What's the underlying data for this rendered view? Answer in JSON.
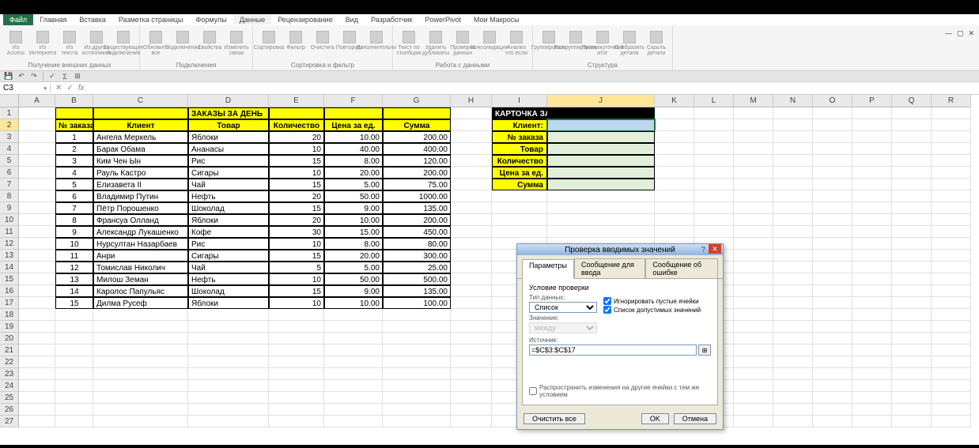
{
  "namebox": "C3",
  "ribbon_tabs": {
    "file": "Файл",
    "items": [
      "Главная",
      "Вставка",
      "Разметка страницы",
      "Формулы",
      "Данные",
      "Рецензирование",
      "Вид",
      "Разработчик",
      "PowerPivot",
      "Мои Макросы"
    ],
    "active_index": 4
  },
  "ribbon_groups": [
    {
      "label": "Получение внешних данных",
      "icons": [
        "Из Access",
        "Из Интернета",
        "Из текста",
        "Из других источников",
        "Существующие подключения"
      ]
    },
    {
      "label": "Подключения",
      "icons": [
        "Обновить все",
        "Подключения",
        "Свойства",
        "Изменить связи"
      ]
    },
    {
      "label": "Сортировка и фильтр",
      "icons": [
        "Сортировка",
        "Фильтр",
        "Очистить",
        "Повторить",
        "Дополнительно"
      ]
    },
    {
      "label": "Работа с данными",
      "icons": [
        "Текст по столбцам",
        "Удалить дубликаты",
        "Проверка данных",
        "Консолидация",
        "Анализ что если"
      ]
    },
    {
      "label": "Структура",
      "icons": [
        "Группировать",
        "Разгруппировать",
        "Промежуточный итог",
        "Отобразить детали",
        "Скрыть детали"
      ]
    }
  ],
  "col_letters": [
    "A",
    "B",
    "C",
    "D",
    "E",
    "F",
    "G",
    "H",
    "I",
    "J",
    "K",
    "L",
    "M",
    "N",
    "O",
    "P",
    "Q",
    "R"
  ],
  "row_numbers": [
    1,
    2,
    3,
    4,
    5,
    6,
    7,
    8,
    9,
    10,
    11,
    12,
    13,
    14,
    15,
    16,
    17,
    18,
    19,
    20,
    21,
    22,
    23,
    24,
    25,
    26,
    27
  ],
  "left_table": {
    "title": "ЗАКАЗЫ ЗА ДЕНЬ",
    "headers": [
      "№ заказа",
      "Клиент",
      "Товар",
      "Количество",
      "Цена за ед.",
      "Сумма"
    ],
    "rows": [
      [
        "1",
        "Ангела Меркель",
        "Яблоки",
        "20",
        "10.00",
        "200.00"
      ],
      [
        "2",
        "Барак Обама",
        "Ананасы",
        "10",
        "40.00",
        "400.00"
      ],
      [
        "3",
        "Ким Чен Ын",
        "Рис",
        "15",
        "8.00",
        "120.00"
      ],
      [
        "4",
        "Рауль Кастро",
        "Сигары",
        "10",
        "20.00",
        "200.00"
      ],
      [
        "5",
        "Елизавета II",
        "Чай",
        "15",
        "5.00",
        "75.00"
      ],
      [
        "6",
        "Владимир Путин",
        "Нефть",
        "20",
        "50.00",
        "1000.00"
      ],
      [
        "7",
        "Пётр Порошенко",
        "Шоколад",
        "15",
        "9.00",
        "135.00"
      ],
      [
        "8",
        "Франсуа Олланд",
        "Яблоки",
        "20",
        "10.00",
        "200.00"
      ],
      [
        "9",
        "Александр Лукашенко",
        "Кофе",
        "30",
        "15.00",
        "450.00"
      ],
      [
        "10",
        "Нурсултан Назарбаев",
        "Рис",
        "10",
        "8.00",
        "80.00"
      ],
      [
        "11",
        "Анри",
        "Сигары",
        "15",
        "20.00",
        "300.00"
      ],
      [
        "12",
        "Томислав Николич",
        "Чай",
        "5",
        "5.00",
        "25.00"
      ],
      [
        "13",
        "Милош Земан",
        "Нефть",
        "10",
        "50.00",
        "500.00"
      ],
      [
        "14",
        "Каролос Папульяс",
        "Шоколад",
        "15",
        "9.00",
        "135.00"
      ],
      [
        "15",
        "Дилма Русеф",
        "Яблоки",
        "10",
        "10.00",
        "100.00"
      ]
    ]
  },
  "right_card": {
    "title": "КАРТОЧКА ЗАКАЗА КЛИЕНТА",
    "labels": [
      "Клиент:",
      "№ заказа",
      "Товар",
      "Количество",
      "Цена за ед.",
      "Сумма"
    ]
  },
  "dialog": {
    "title": "Проверка вводимых значений",
    "tabs": [
      "Параметры",
      "Сообщение для ввода",
      "Сообщение об ошибке"
    ],
    "section": "Условие проверки",
    "type_label": "Тип данных:",
    "type_value": "Список",
    "value_label": "Значение:",
    "value_value": "между",
    "chk_ignore": "Игнорировать пустые ячейки",
    "chk_dropdown": "Список допустимых значений",
    "source_label": "Источник:",
    "source_value": "=$C$3:$C$17",
    "spread_label": "Распространить изменения на другие ячейки с тем же условием",
    "btn_clear": "Очистить все",
    "btn_ok": "OK",
    "btn_cancel": "Отмена"
  }
}
